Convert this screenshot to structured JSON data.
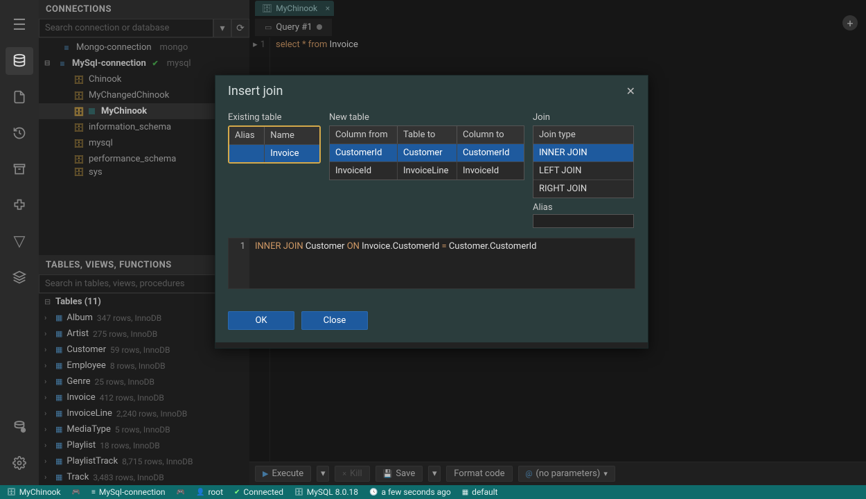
{
  "activity": {
    "items": [
      "menu",
      "database",
      "file",
      "history",
      "archive",
      "package",
      "filter",
      "layers",
      "eye",
      "settings"
    ]
  },
  "connections": {
    "title": "CONNECTIONS",
    "search_placeholder": "Search connection or database",
    "items": [
      {
        "name": "Mongo-connection",
        "engine": "mongo",
        "bold": false,
        "indent": 1,
        "icon": "dbconn"
      },
      {
        "name": "MySql-connection",
        "engine": "mysql",
        "bold": true,
        "indent": 0,
        "icon": "dbconn",
        "check": true,
        "toggle": "⊟"
      },
      {
        "name": "Chinook",
        "indent": 2,
        "icon": "db"
      },
      {
        "name": "MyChangedChinook",
        "indent": 2,
        "icon": "db"
      },
      {
        "name": "MyChinook",
        "indent": 2,
        "icon": "db",
        "selected": true,
        "sq": true
      },
      {
        "name": "information_schema",
        "indent": 2,
        "icon": "db"
      },
      {
        "name": "mysql",
        "indent": 2,
        "icon": "db"
      },
      {
        "name": "performance_schema",
        "indent": 2,
        "icon": "db"
      },
      {
        "name": "sys",
        "indent": 2,
        "icon": "db",
        "cut": true
      }
    ]
  },
  "tables_panel": {
    "title": "TABLES, VIEWS, FUNCTIONS",
    "search_placeholder": "Search in tables, views, procedures",
    "group_label": "Tables (11)",
    "tables": [
      {
        "name": "Album",
        "meta": "347 rows, InnoDB"
      },
      {
        "name": "Artist",
        "meta": "275 rows, InnoDB"
      },
      {
        "name": "Customer",
        "meta": "59 rows, InnoDB"
      },
      {
        "name": "Employee",
        "meta": "8 rows, InnoDB"
      },
      {
        "name": "Genre",
        "meta": "25 rows, InnoDB"
      },
      {
        "name": "Invoice",
        "meta": "412 rows, InnoDB"
      },
      {
        "name": "InvoiceLine",
        "meta": "2,240 rows, InnoDB"
      },
      {
        "name": "MediaType",
        "meta": "5 rows, InnoDB"
      },
      {
        "name": "Playlist",
        "meta": "18 rows, InnoDB"
      },
      {
        "name": "PlaylistTrack",
        "meta": "8,715 rows, InnoDB"
      },
      {
        "name": "Track",
        "meta": "3,483 rows, InnoDB"
      }
    ]
  },
  "tabs": {
    "context": "MyChinook",
    "file": "Query #1"
  },
  "editor": {
    "line_no": "1",
    "tokens": {
      "select": "select",
      "star": "*",
      "from": "from",
      "table": "Invoice"
    }
  },
  "toolbar": {
    "execute": "Execute",
    "kill": "Kill",
    "save": "Save",
    "format": "Format code",
    "params": "(no parameters)"
  },
  "status": {
    "db": "MyChinook",
    "conn": "MySql-connection",
    "user": "root",
    "state": "Connected",
    "server": "MySQL 8.0.18",
    "time": "a few seconds ago",
    "schema": "default"
  },
  "modal": {
    "title": "Insert join",
    "existing": {
      "label": "Existing table",
      "headers": {
        "alias": "Alias",
        "name": "Name"
      },
      "rows": [
        {
          "alias": "",
          "name": "Invoice",
          "selected": true
        }
      ]
    },
    "newtable": {
      "label": "New table",
      "headers": {
        "col_from": "Column from",
        "table_to": "Table to",
        "col_to": "Column to"
      },
      "rows": [
        {
          "col_from": "CustomerId",
          "table_to": "Customer",
          "col_to": "CustomerId",
          "selected": true
        },
        {
          "col_from": "InvoiceId",
          "table_to": "InvoiceLine",
          "col_to": "InvoiceId",
          "selected": false
        }
      ]
    },
    "join": {
      "label": "Join",
      "header": "Join type",
      "options": [
        {
          "label": "INNER JOIN",
          "selected": true
        },
        {
          "label": "LEFT JOIN",
          "selected": false
        },
        {
          "label": "RIGHT JOIN",
          "selected": false
        }
      ],
      "alias_label": "Alias"
    },
    "preview": {
      "line_no": "1",
      "tokens": {
        "inner_join": "INNER JOIN",
        "customer": "Customer",
        "on": "ON",
        "left": "Invoice.CustomerId",
        "eq": "=",
        "right": "Customer.CustomerId"
      }
    },
    "buttons": {
      "ok": "OK",
      "close": "Close"
    }
  }
}
